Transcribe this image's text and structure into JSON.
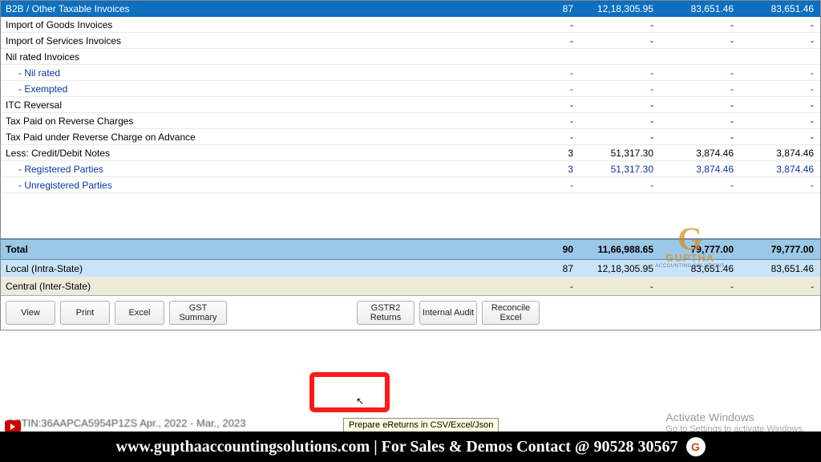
{
  "rows": [
    {
      "label": "B2B / Other Taxable Invoices",
      "cnt": "87",
      "a1": "12,18,305.95",
      "a2": "83,651.46",
      "a3": "83,651.46",
      "cls": "header"
    },
    {
      "label": "Import of Goods Invoices",
      "cnt": "-",
      "a1": "-",
      "a2": "-",
      "a3": "-",
      "cls": ""
    },
    {
      "label": "Import of Services Invoices",
      "cnt": "-",
      "a1": "-",
      "a2": "-",
      "a3": "-",
      "cls": ""
    },
    {
      "label": "Nil rated Invoices",
      "cnt": "",
      "a1": "",
      "a2": "",
      "a3": "",
      "cls": ""
    },
    {
      "label": "- Nil rated",
      "cnt": "-",
      "a1": "-",
      "a2": "-",
      "a3": "-",
      "cls": "sub"
    },
    {
      "label": "- Exempted",
      "cnt": "-",
      "a1": "-",
      "a2": "-",
      "a3": "-",
      "cls": "sub"
    },
    {
      "label": "ITC Reversal",
      "cnt": "-",
      "a1": "-",
      "a2": "-",
      "a3": "-",
      "cls": ""
    },
    {
      "label": "Tax Paid on Reverse Charges",
      "cnt": "-",
      "a1": "-",
      "a2": "-",
      "a3": "-",
      "cls": ""
    },
    {
      "label": "Tax Paid under Reverse Charge on Advance",
      "cnt": "-",
      "a1": "-",
      "a2": "-",
      "a3": "-",
      "cls": ""
    },
    {
      "label": "Less: Credit/Debit Notes",
      "cnt": "3",
      "a1": "51,317.30",
      "a2": "3,874.46",
      "a3": "3,874.46",
      "cls": ""
    },
    {
      "label": "- Registered Parties",
      "cnt": "3",
      "a1": "51,317.30",
      "a2": "3,874.46",
      "a3": "3,874.46",
      "cls": "sub"
    },
    {
      "label": "- Unregistered Parties",
      "cnt": "-",
      "a1": "-",
      "a2": "-",
      "a3": "-",
      "cls": "sub"
    }
  ],
  "summary": {
    "total": {
      "label": "Total",
      "cnt": "90",
      "a1": "11,66,988.65",
      "a2": "79,777.00",
      "a3": "79,777.00"
    },
    "local": {
      "label": "Local (Intra-State)",
      "cnt": "87",
      "a1": "12,18,305.95",
      "a2": "83,651.46",
      "a3": "83,651.46"
    },
    "central": {
      "label": "Central (Inter-State)",
      "cnt": "-",
      "a1": "-",
      "a2": "-",
      "a3": "-"
    }
  },
  "buttons": {
    "view": "View",
    "print": "Print",
    "excel": "Excel",
    "gst": "GST Summary",
    "gstr2": "GSTR2 Returns",
    "audit": "Internal Audit",
    "reconcile": "Reconcile Excel"
  },
  "tooltip": "Prepare eReturns in CSV/Excel/Json",
  "status": "GSTIN:36AAPCA5954P1ZS  Apr., 2022 - Mar., 2023",
  "activate": {
    "title": "Activate Windows",
    "sub": "Go to Settings to activate Windows."
  },
  "banner": "www.gupthaaccountingsolutions.com | For Sales & Demos Contact @ 90528 30567",
  "watermark": {
    "name": "GUPTHA",
    "tag": "ACCOUNTING SOLUTIONS"
  }
}
